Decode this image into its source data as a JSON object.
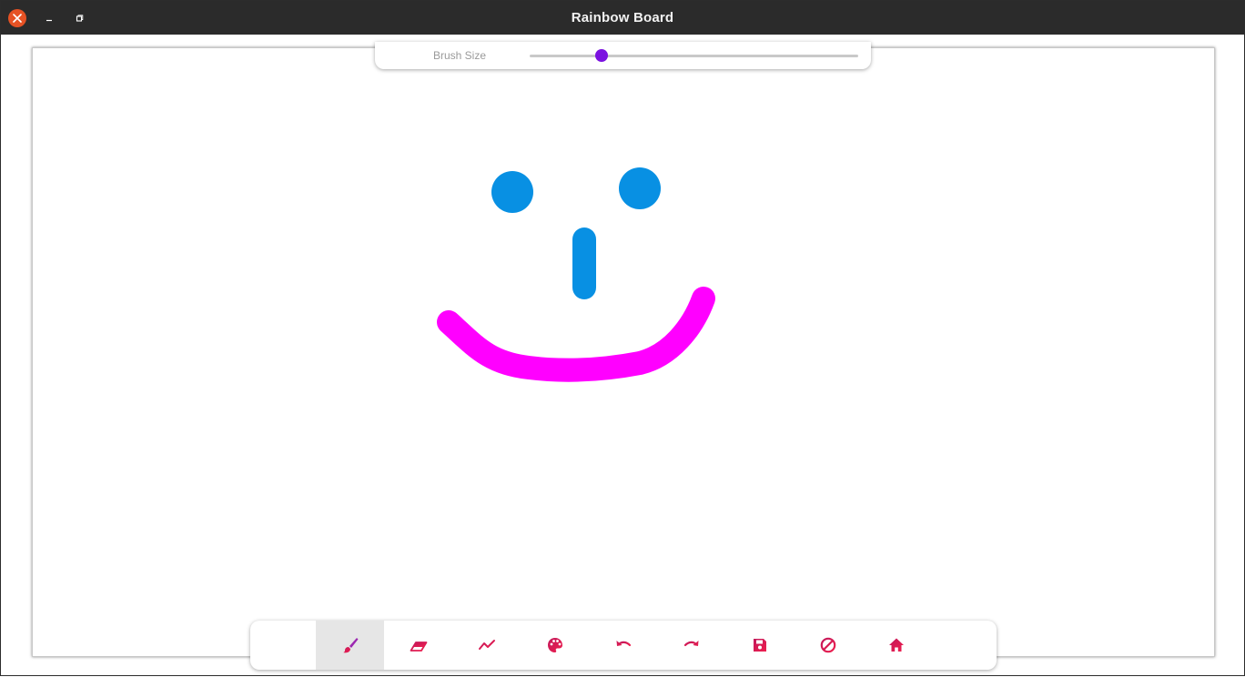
{
  "window": {
    "title": "Rainbow Board",
    "close_icon": "close-icon",
    "minimize_icon": "minimize-icon",
    "maximize_icon": "maximize-icon",
    "colors": {
      "titlebar": "#2b2b2b",
      "close": "#e65224"
    }
  },
  "brush": {
    "label": "Brush Size",
    "value_fraction": 0.22,
    "thumb_color": "#7b12e0"
  },
  "drawing": {
    "strokes": [
      {
        "name": "left-eye",
        "color": "#0890e3"
      },
      {
        "name": "right-eye",
        "color": "#0890e3"
      },
      {
        "name": "nose",
        "color": "#0890e3"
      },
      {
        "name": "mouth",
        "color": "#ff00ff"
      }
    ]
  },
  "toolbar": {
    "active_tool": "brush",
    "tools": [
      {
        "id": "brush",
        "icon": "paintbrush-icon"
      },
      {
        "id": "eraser",
        "icon": "eraser-icon"
      },
      {
        "id": "line",
        "icon": "polyline-icon"
      },
      {
        "id": "palette",
        "icon": "palette-icon"
      },
      {
        "id": "undo",
        "icon": "undo-icon"
      },
      {
        "id": "redo",
        "icon": "redo-icon"
      },
      {
        "id": "save",
        "icon": "save-icon"
      },
      {
        "id": "clear",
        "icon": "clear-icon"
      },
      {
        "id": "home",
        "icon": "home-icon"
      }
    ],
    "icon_gradient": [
      "#c2185b",
      "#ef1f4e"
    ]
  }
}
